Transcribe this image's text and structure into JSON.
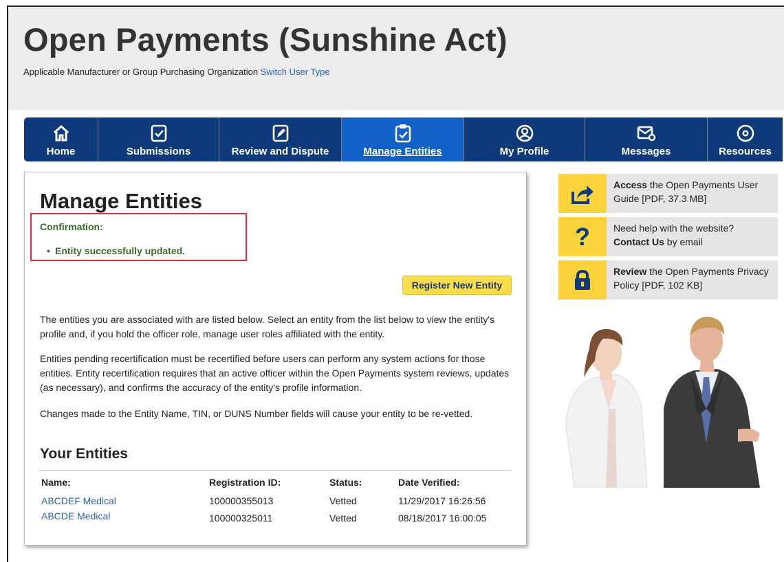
{
  "header": {
    "title": "Open Payments (Sunshine Act)",
    "user_type": "Applicable Manufacturer or Group Purchasing Organization",
    "switch_link": "Switch User Type"
  },
  "nav": {
    "items": [
      {
        "label": "Home",
        "icon": "home-icon"
      },
      {
        "label": "Submissions",
        "icon": "checklist-icon"
      },
      {
        "label": "Review and Dispute",
        "icon": "edit-document-icon"
      },
      {
        "label": "Manage Entities",
        "icon": "clipboard-icon",
        "active": true
      },
      {
        "label": "My Profile",
        "icon": "user-icon"
      },
      {
        "label": "Messages",
        "icon": "envelope-icon"
      },
      {
        "label": "Resources",
        "icon": "gear-icon"
      }
    ]
  },
  "main": {
    "heading": "Manage Entities",
    "confirmation": {
      "title": "Confirmation:",
      "message": "Entity successfully updated."
    },
    "register_button": "Register New Entity",
    "paragraphs": [
      "The entities you are associated with are listed below. Select an entity from the list below to view the entity's profile and, if you hold the officer role, manage user roles affiliated with the entity.",
      "Entities pending recertification must be recertified before users can perform any system actions for those entities. Entity recertification requires that an active officer within the Open Payments system reviews, updates (as necessary), and confirms the accuracy of the entity's profile information.",
      "Changes made to the Entity Name, TIN, or DUNS Number fields will cause your entity to be re-vetted."
    ],
    "entities_heading": "Your Entities",
    "table": {
      "columns": [
        "Name:",
        "Registration ID:",
        "Status:",
        "Date Verified:"
      ],
      "rows": [
        {
          "name": "ABCDEF Medical",
          "registration_id": "100000355013",
          "status": "Vetted",
          "date_verified": "11/29/2017 16:26:56"
        },
        {
          "name": "ABCDE Medical",
          "registration_id": "100000325011",
          "status": "Vetted",
          "date_verified": "08/18/2017 16:00:05"
        }
      ]
    }
  },
  "sidebar": {
    "cards": [
      {
        "icon": "share-arrow-icon",
        "bold": "Access",
        "text": " the Open Payments User Guide [PDF, 37.3 MB]"
      },
      {
        "icon": "question-mark-icon",
        "pre": "Need help with the website?",
        "bold": "Contact Us",
        "text": " by email",
        "glyph": "?"
      },
      {
        "icon": "lock-icon",
        "bold": "Review",
        "text": " the Open Payments Privacy Policy [PDF, 102 KB]"
      }
    ]
  },
  "colors": {
    "nav_bg": "#0e3a7c",
    "nav_active": "#1261c9",
    "accent_yellow": "#fbd33a",
    "confirm_green": "#3b6b2b",
    "alert_red": "#d9343b",
    "link_blue": "#2d62b5"
  }
}
